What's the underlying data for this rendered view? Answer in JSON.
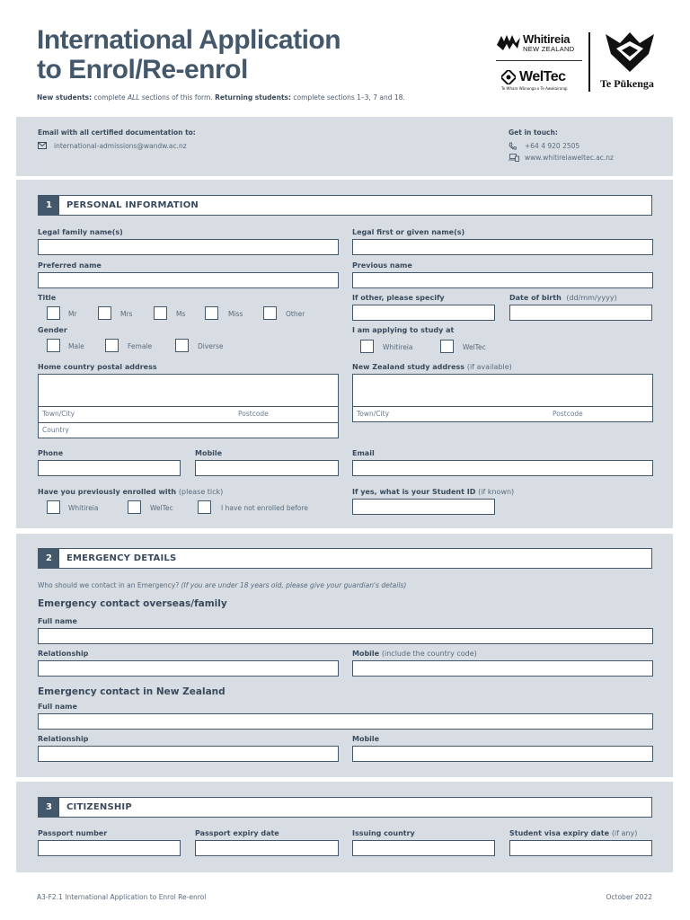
{
  "header": {
    "title_line1": "International Application",
    "title_line2": "to Enrol/Re-enrol",
    "intro_new_label": "New students:",
    "intro_new_text_a": " complete ",
    "intro_new_all": "ALL",
    "intro_new_text_b": " sections of this form.  ",
    "intro_returning_label": "Returning students:",
    "intro_returning_text": " complete sections 1–3, 7 and 18."
  },
  "logos": {
    "whitireia_name": "Whitireia",
    "whitireia_sub": "NEW ZEALAND",
    "weltec_name": "WelTec",
    "weltec_sub": "Te Whare Wānanga o Te Awakairangi",
    "tp_name": "Te Pūkenga"
  },
  "contact": {
    "email_heading": "Email with all certified documentation to:",
    "email": "international-admissions@wandw.ac.nz",
    "get_in_touch": "Get in touch:",
    "phone": "+64 4 920 2505",
    "website": "www.whitireiaweltec.ac.nz"
  },
  "section1": {
    "number": "1",
    "title": "PERSONAL INFORMATION",
    "legal_family_name": "Legal family name(s)",
    "legal_first_name": "Legal first or given name(s)",
    "preferred_name": "Preferred name",
    "previous_name": "Previous name",
    "title_label": "Title",
    "title_options": [
      "Mr",
      "Mrs",
      "Ms",
      "Miss",
      "Other"
    ],
    "if_other": "If other, please specify",
    "dob_label": "Date of birth",
    "dob_hint": "(dd/mm/yyyy)",
    "gender_label": "Gender",
    "gender_options": [
      "Male",
      "Female",
      "Diverse"
    ],
    "applying_label": "I am applying to study at",
    "applying_options": [
      "Whitireia",
      "WelTec"
    ],
    "home_address": "Home country postal address",
    "nz_address": "New Zealand study address",
    "nz_address_hint": "(if available)",
    "town_city": "Town/City",
    "postcode": "Postcode",
    "country": "Country",
    "phone": "Phone",
    "mobile": "Mobile",
    "email": "Email",
    "prev_enrolled_label": "Have you previously enrolled with",
    "prev_enrolled_hint": "(please tick)",
    "prev_enrolled_options": [
      "Whitireia",
      "WelTec",
      "I have not enrolled before"
    ],
    "student_id_label": "If yes, what  is your Student ID",
    "student_id_hint": "(if known)"
  },
  "section2": {
    "number": "2",
    "title": "EMERGENCY DETAILS",
    "question": "Who should we contact in an Emergency?",
    "question_hint": "(If you are under 18 years old, please give your guardian's details)",
    "overseas_heading": "Emergency contact overseas/family",
    "full_name": "Full name",
    "relationship": "Relationship",
    "mobile": "Mobile",
    "mobile_hint": "(include the country code)",
    "nz_heading": "Emergency contact in New Zealand"
  },
  "section3": {
    "number": "3",
    "title": "CITIZENSHIP",
    "passport_number": "Passport number",
    "passport_expiry": "Passport expiry date",
    "issuing_country": "Issuing country",
    "visa_expiry": "Student visa expiry date",
    "visa_expiry_hint": "(if any)"
  },
  "footer": {
    "doc_code": "A3-F2.1 International Application to Enrol Re-enrol",
    "date": "October 2022"
  }
}
